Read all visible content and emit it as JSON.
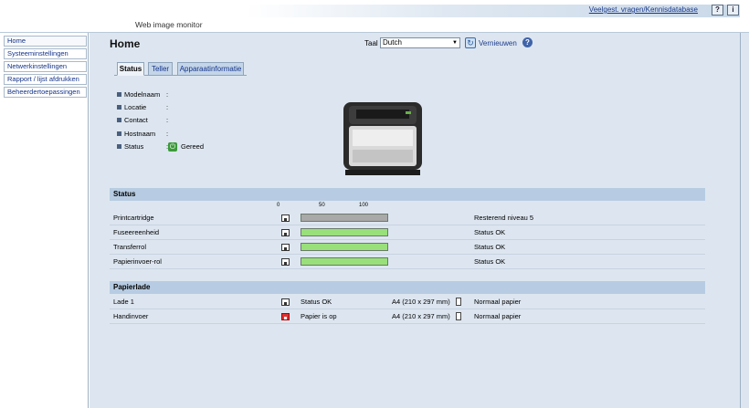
{
  "header": {
    "brand": "Web image monitor",
    "faq_link": "Veelgest. vragen/Kennisdatabase",
    "help_btn": "?",
    "info_btn": "i"
  },
  "sidebar": {
    "items": [
      {
        "label": "Home"
      },
      {
        "label": "Systeeminstellingen"
      },
      {
        "label": "Netwerkinstellingen"
      },
      {
        "label": "Rapport / lijst afdrukken"
      },
      {
        "label": "Beheerdertoepassingen"
      }
    ]
  },
  "main": {
    "title": "Home",
    "language_label": "Taal",
    "language_value": "Dutch",
    "refresh_label": "Vernieuwen",
    "tabs": [
      {
        "label": "Status"
      },
      {
        "label": "Teller"
      },
      {
        "label": "Apparaatinformatie"
      }
    ],
    "info": [
      {
        "label": "Modelnaam",
        "value": ""
      },
      {
        "label": "Locatie",
        "value": ""
      },
      {
        "label": "Contact",
        "value": ""
      },
      {
        "label": "Hostnaam",
        "value": ""
      },
      {
        "label": "Status",
        "value": "Gereed"
      }
    ],
    "status_section": {
      "title": "Status",
      "scale": [
        "0",
        "50",
        "100"
      ],
      "rows": [
        {
          "name": "Printcartridge",
          "level": 1.0,
          "bar_color": "#a9a9a9",
          "status": "Resterend niveau 5"
        },
        {
          "name": "Fuseereenheid",
          "level": 1.0,
          "bar_color": "#99e07a",
          "status": "Status OK"
        },
        {
          "name": "Transferrol",
          "level": 1.0,
          "bar_color": "#99e07a",
          "status": "Status OK"
        },
        {
          "name": "Papierinvoer-rol",
          "level": 1.0,
          "bar_color": "#99e07a",
          "status": "Status OK"
        }
      ]
    },
    "paper_section": {
      "title": "Papierlade",
      "rows": [
        {
          "name": "Lade 1",
          "status": "Status OK",
          "size": "A4 (210 x 297 mm)",
          "type": "Normaal papier"
        },
        {
          "name": "Handinvoer",
          "status": "Papier is op",
          "size": "A4 (210 x 297 mm)",
          "type": "Normaal papier"
        }
      ]
    }
  },
  "colors": {
    "accent": "#1a3a8a",
    "panel": "#dde6f0",
    "section_header": "#b7cce2",
    "ok": "#3a9a3a",
    "error": "#d33333"
  }
}
